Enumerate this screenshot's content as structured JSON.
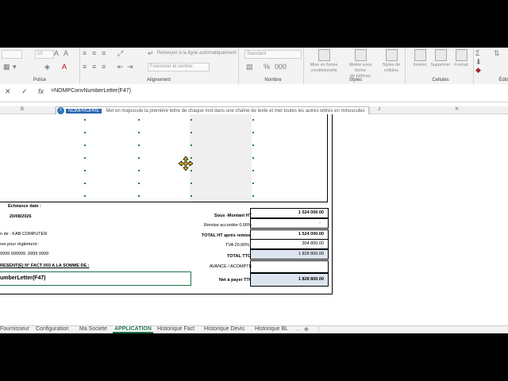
{
  "ribbon": {
    "font_size": "10",
    "wrap_label": "Renvoyer à la ligne automatiquement",
    "merge_label": "Fusionner et centrer",
    "number_format": "Standard",
    "cond_format": [
      "Mise en forme",
      "conditionnelle"
    ],
    "format_table": [
      "Mettre sous forme",
      "de tableau"
    ],
    "cell_styles": [
      "Styles de",
      "cellules"
    ],
    "insert": "Insérer",
    "delete": "Supprimer",
    "format": "Format",
    "groups": {
      "police": "Police",
      "alignement": "Alignement",
      "nombre": "Nombre",
      "styles": "Styles",
      "cellules": "Cellules",
      "edition": "Éditi"
    }
  },
  "formula_bar": {
    "cancel": "✕",
    "enter": "✓",
    "fx": "fx",
    "formula": "=NOMPConvNumberLetter(F47)"
  },
  "tooltip": {
    "icon": "f",
    "function": "NOMPROPRE",
    "description": "Met en majuscule la première lettre de chaque mot dans une chaîne de texte et met toutes les autres lettres en minuscules"
  },
  "columns": [
    "B",
    "J",
    "K"
  ],
  "invoice": {
    "echeance_label": "Échéance date :",
    "echeance_date": "20/08/2026",
    "company_line": "n de : KAB COMPUTER",
    "payment_line": "res pour règlement :",
    "phone": "9999  999999  .9999  9999",
    "sum_line": "RESENT(E) N° FACT  003 A LA SOMME DE :",
    "formula_cell": "umberLetter(F47)",
    "totals": [
      {
        "label": "Sous -Montant HT",
        "value": "1 524 000.00"
      },
      {
        "label": "Remise accordée 0.00%",
        "value": "-"
      },
      {
        "label": "TOTAL  HT après remise",
        "value": "1 524 000.00"
      },
      {
        "label": "TVA 20.00%",
        "value": "304 800.00"
      },
      {
        "label": "TOTAL TTC",
        "value": "1 828 800.00"
      },
      {
        "label": "AVANCE / ACOMPTE",
        "value": ""
      },
      {
        "label": "Net à payer TTC",
        "value": "1 828 800.00"
      }
    ]
  },
  "sheet_tabs": [
    "Fournisseur",
    "Configuration",
    "Ma Societe",
    "APPLICATION",
    "Historique Fact",
    "Historique Devis",
    "Historique BL"
  ],
  "active_tab": "APPLICATION",
  "colors": {
    "excel_green": "#217346",
    "input_fill": "#dde4f0",
    "shade": "#efefef"
  }
}
